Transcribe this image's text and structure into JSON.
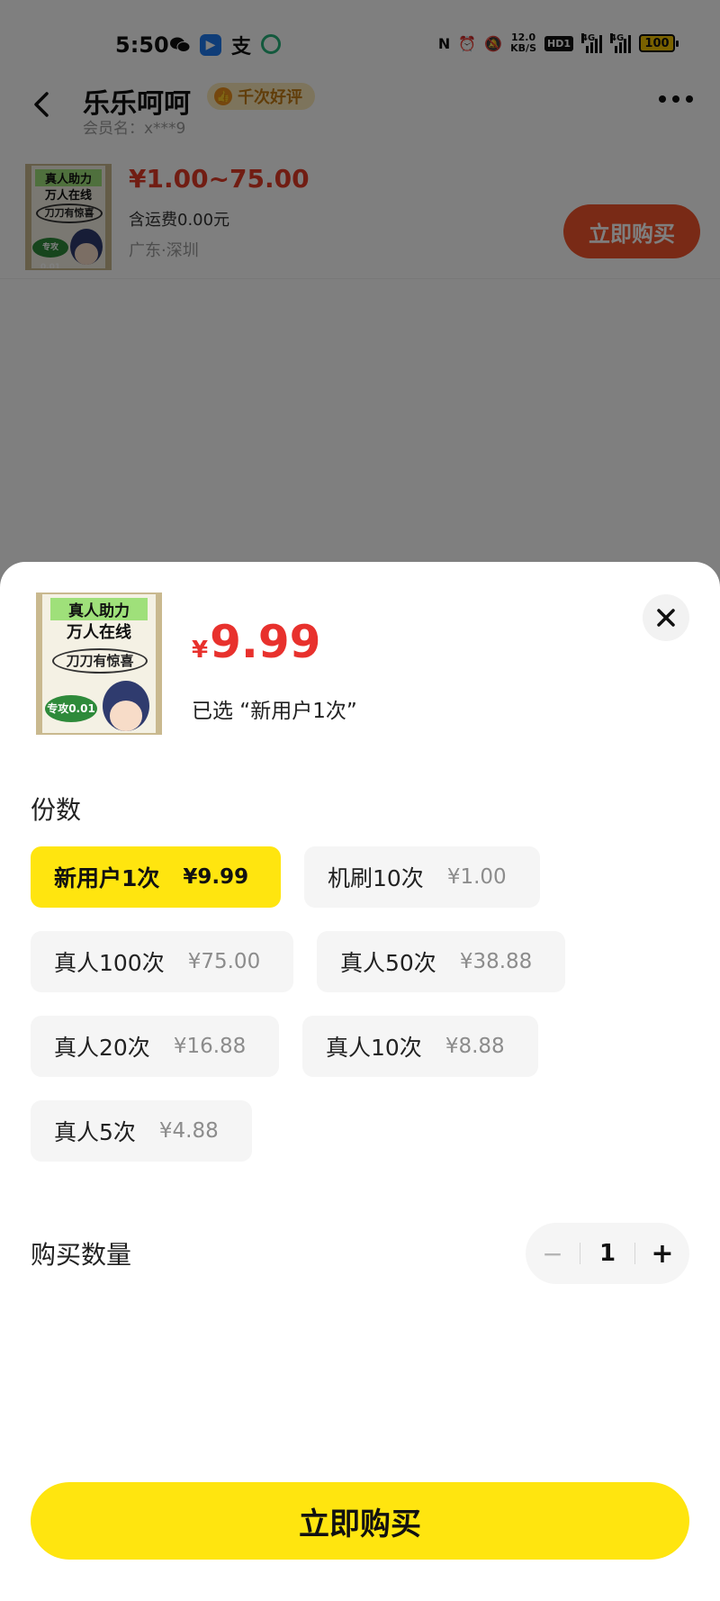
{
  "status_bar": {
    "time": "5:50",
    "net_speed": "12.0",
    "net_speed_unit": "KB/S",
    "hd_label": "HD1",
    "sig1_label": "4G",
    "sig2_label": "4G",
    "battery": "100"
  },
  "header": {
    "seller_name": "乐乐呵呵",
    "badge": "千次好评",
    "member_id": "会员名：x***9"
  },
  "product": {
    "price_range": "¥1.00~75.00",
    "shipping": "含运费0.00元",
    "location": "广东·深圳",
    "buy_button": "立即购买",
    "image_text": {
      "line1": "真人助力",
      "line2": "万人在线",
      "line3": "刀刀有惊喜",
      "tag": "专攻0.01"
    }
  },
  "sheet": {
    "currency": "¥",
    "price": "9.99",
    "selected": "已选 “新用户1次”",
    "section_title": "份数",
    "options": [
      {
        "label": "新用户1次",
        "price": "¥9.99",
        "selected": true
      },
      {
        "label": "机刷10次",
        "price": "¥1.00",
        "selected": false
      },
      {
        "label": "真人100次",
        "price": "¥75.00",
        "selected": false
      },
      {
        "label": "真人50次",
        "price": "¥38.88",
        "selected": false
      },
      {
        "label": "真人20次",
        "price": "¥16.88",
        "selected": false
      },
      {
        "label": "真人10次",
        "price": "¥8.88",
        "selected": false
      },
      {
        "label": "真人5次",
        "price": "¥4.88",
        "selected": false
      }
    ],
    "quantity_label": "购买数量",
    "quantity": "1",
    "minus": "−",
    "plus": "+",
    "buy_button": "立即购买"
  },
  "colors": {
    "accent_yellow": "#ffe50f",
    "price_red": "#e8312d",
    "buy_orange": "#f2552c"
  },
  "icons": [
    "wechat-icon",
    "app-icon",
    "alipay-icon",
    "green-app-icon",
    "nfc-icon",
    "alarm-icon",
    "mute-icon",
    "back-icon",
    "more-icon",
    "close-icon",
    "thumbs-up-icon"
  ]
}
